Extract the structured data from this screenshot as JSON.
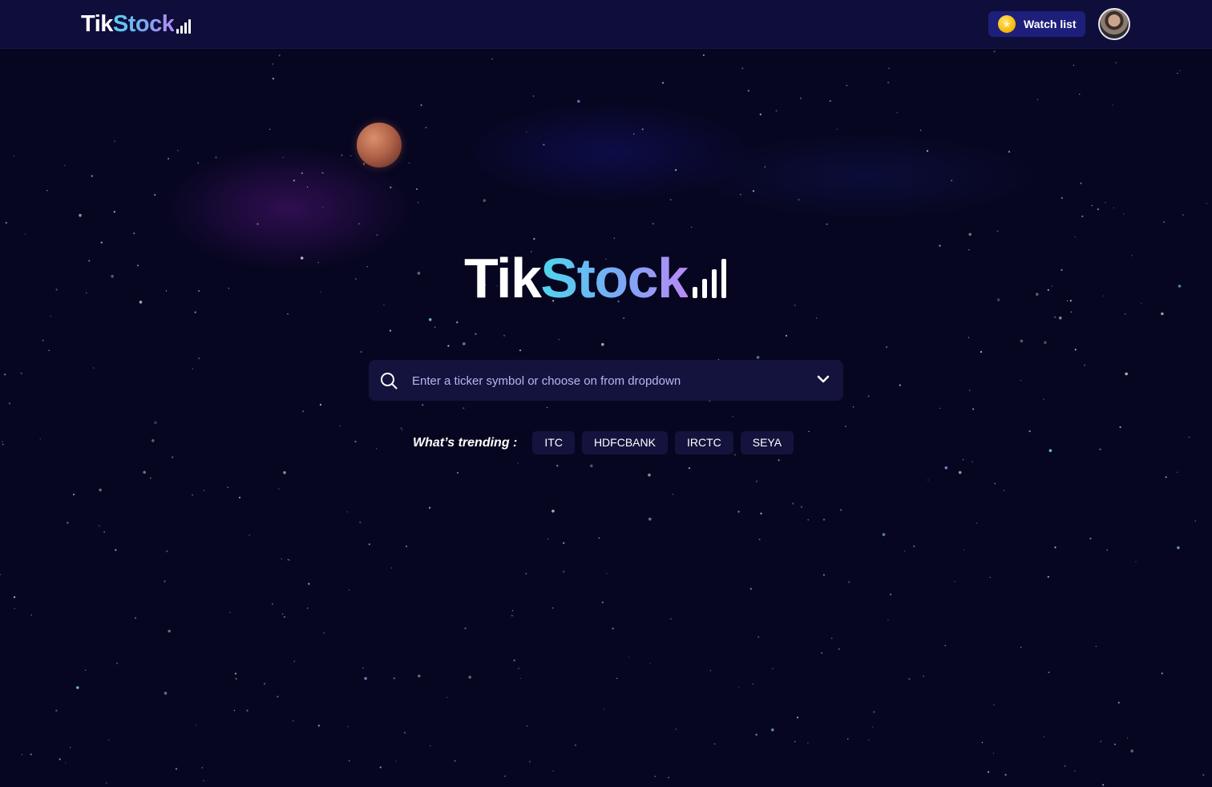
{
  "app": {
    "name_part1": "Tik",
    "name_part2": "Stock"
  },
  "header": {
    "watchlist_label": "Watch list"
  },
  "hero": {
    "logo_part1": "Tik",
    "logo_part2": "Stock"
  },
  "search": {
    "placeholder": "Enter a ticker symbol or choose on from dropdown",
    "value": ""
  },
  "trending": {
    "label": "What’s trending :",
    "items": [
      "ITC",
      "HDFCBANK",
      "IRCTC",
      "SEYA"
    ]
  },
  "colors": {
    "background": "#070620",
    "navbar": "#0f0e3a",
    "button_accent": "#1d1f7a",
    "chip_bg": "#14133d",
    "placeholder_text": "#b8b6f2",
    "brand_gradient_start": "#4fd6ee",
    "brand_gradient_end": "#b98af4"
  },
  "icons": {
    "search": "search-icon",
    "dropdown": "chevron-down-icon",
    "coin": "star-coin-icon",
    "signal": "signal-bars-icon"
  }
}
